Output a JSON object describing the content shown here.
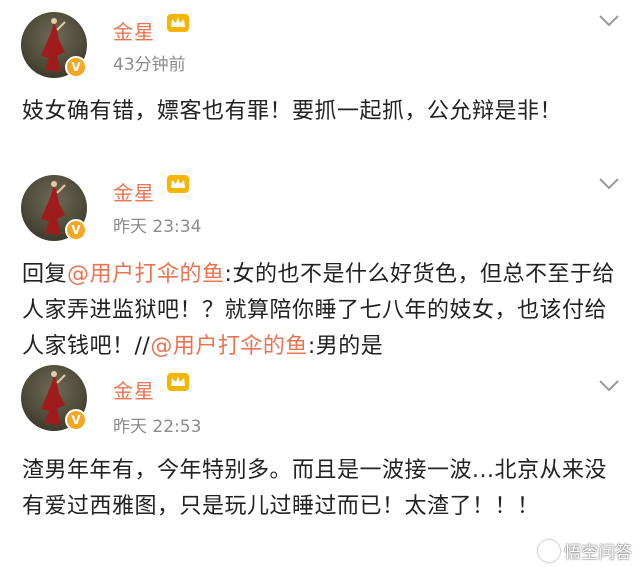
{
  "posts": [
    {
      "author": "金星",
      "time": "43分钟前",
      "text": "妓女确有错，嫖客也有罪！要抓一起抓，公允辩是非！"
    },
    {
      "author": "金星",
      "time": "昨天 23:34",
      "reply_prefix": "回复",
      "mention1": "@用户打伞的鱼",
      "text_a": ":女的也不是什么好货色，但总不至于给人家弄进监狱吧！？就算陪你睡了七八年的妓女，也该付给人家钱吧！",
      "repost_marker": "//",
      "mention2": "@用户打伞的鱼",
      "text_b": ":男的是"
    },
    {
      "author": "金星",
      "time": "昨天 22:53",
      "text": "渣男年年有，今年特别多。而且是一波接一波...北京从来没有爱过西雅图，只是玩儿过睡过而已！太渣了！！！"
    }
  ],
  "verified_badge": "V",
  "watermark": "悟空问答",
  "colors": {
    "name": "#eb7350",
    "mention": "#eb7350",
    "time": "#8c8c8c",
    "badge": "#f5a623"
  },
  "icons": [
    "avatar",
    "verified-badge-icon",
    "vip-crown-icon",
    "chevron-down-icon",
    "wukong-logo-icon"
  ]
}
